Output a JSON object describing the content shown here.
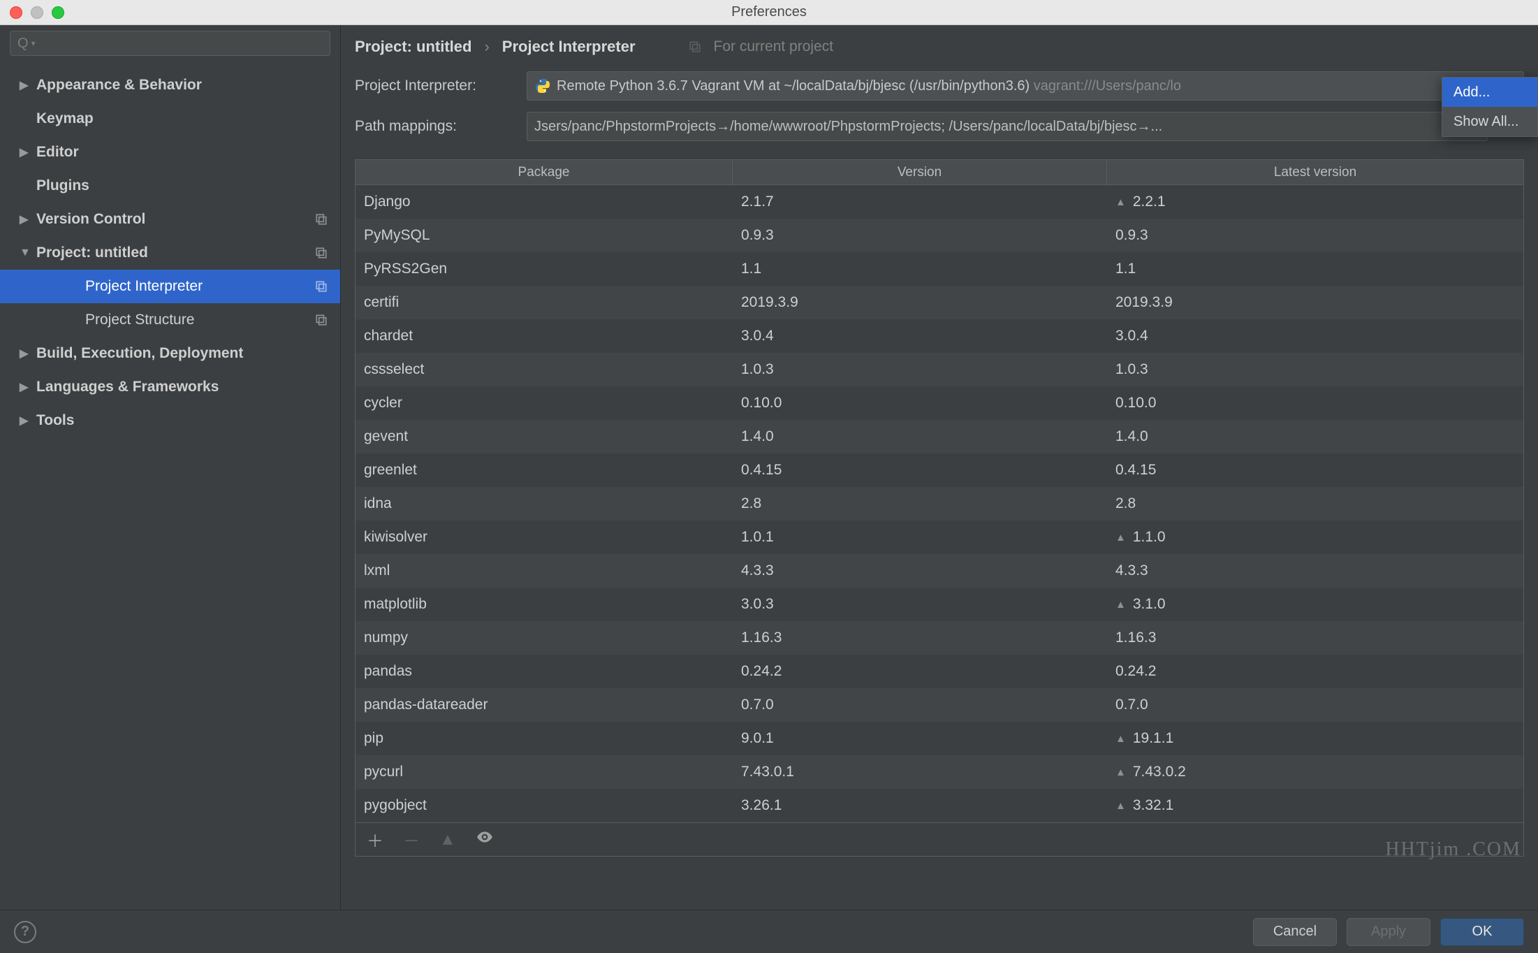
{
  "window": {
    "title": "Preferences"
  },
  "search": {
    "placeholder": "Q▾"
  },
  "sidebar": {
    "items": [
      {
        "label": "Appearance & Behavior",
        "bold": true,
        "arrow": "right",
        "copy": false
      },
      {
        "label": "Keymap",
        "bold": true,
        "arrow": "",
        "copy": false
      },
      {
        "label": "Editor",
        "bold": true,
        "arrow": "right",
        "copy": false
      },
      {
        "label": "Plugins",
        "bold": true,
        "arrow": "",
        "copy": false
      },
      {
        "label": "Version Control",
        "bold": true,
        "arrow": "right",
        "copy": true
      },
      {
        "label": "Project: untitled",
        "bold": true,
        "arrow": "down",
        "copy": true
      },
      {
        "label": "Project Interpreter",
        "bold": false,
        "arrow": "",
        "copy": true,
        "selected": true,
        "grandchild": true
      },
      {
        "label": "Project Structure",
        "bold": false,
        "arrow": "",
        "copy": true,
        "grandchild": true
      },
      {
        "label": "Build, Execution, Deployment",
        "bold": true,
        "arrow": "right",
        "copy": false
      },
      {
        "label": "Languages & Frameworks",
        "bold": true,
        "arrow": "right",
        "copy": false
      },
      {
        "label": "Tools",
        "bold": true,
        "arrow": "right",
        "copy": false
      }
    ]
  },
  "breadcrumb": {
    "root": "Project: untitled",
    "sep": "›",
    "leaf": "Project Interpreter",
    "for_current": "For current project"
  },
  "form": {
    "interpreter_label": "Project Interpreter:",
    "interpreter_value": "Remote Python 3.6.7 Vagrant VM at ~/localData/bj/bjesc (/usr/bin/python3.6)",
    "interpreter_hint": "vagrant:///Users/panc/lo",
    "path_label": "Path mappings:",
    "path_value": "Jsers/panc/PhpstormProjects→/home/wwwroot/PhpstormProjects; /Users/panc/localData/bj/bjesc→..."
  },
  "table": {
    "headers": {
      "pkg": "Package",
      "ver": "Version",
      "lat": "Latest version"
    },
    "rows": [
      {
        "pkg": "Django",
        "ver": "2.1.7",
        "lat": "2.2.1",
        "upgrade": true
      },
      {
        "pkg": "PyMySQL",
        "ver": "0.9.3",
        "lat": "0.9.3",
        "upgrade": false
      },
      {
        "pkg": "PyRSS2Gen",
        "ver": "1.1",
        "lat": "1.1",
        "upgrade": false
      },
      {
        "pkg": "certifi",
        "ver": "2019.3.9",
        "lat": "2019.3.9",
        "upgrade": false
      },
      {
        "pkg": "chardet",
        "ver": "3.0.4",
        "lat": "3.0.4",
        "upgrade": false
      },
      {
        "pkg": "cssselect",
        "ver": "1.0.3",
        "lat": "1.0.3",
        "upgrade": false
      },
      {
        "pkg": "cycler",
        "ver": "0.10.0",
        "lat": "0.10.0",
        "upgrade": false
      },
      {
        "pkg": "gevent",
        "ver": "1.4.0",
        "lat": "1.4.0",
        "upgrade": false
      },
      {
        "pkg": "greenlet",
        "ver": "0.4.15",
        "lat": "0.4.15",
        "upgrade": false
      },
      {
        "pkg": "idna",
        "ver": "2.8",
        "lat": "2.8",
        "upgrade": false
      },
      {
        "pkg": "kiwisolver",
        "ver": "1.0.1",
        "lat": "1.1.0",
        "upgrade": true
      },
      {
        "pkg": "lxml",
        "ver": "4.3.3",
        "lat": "4.3.3",
        "upgrade": false
      },
      {
        "pkg": "matplotlib",
        "ver": "3.0.3",
        "lat": "3.1.0",
        "upgrade": true
      },
      {
        "pkg": "numpy",
        "ver": "1.16.3",
        "lat": "1.16.3",
        "upgrade": false
      },
      {
        "pkg": "pandas",
        "ver": "0.24.2",
        "lat": "0.24.2",
        "upgrade": false
      },
      {
        "pkg": "pandas-datareader",
        "ver": "0.7.0",
        "lat": "0.7.0",
        "upgrade": false
      },
      {
        "pkg": "pip",
        "ver": "9.0.1",
        "lat": "19.1.1",
        "upgrade": true
      },
      {
        "pkg": "pycurl",
        "ver": "7.43.0.1",
        "lat": "7.43.0.2",
        "upgrade": true
      },
      {
        "pkg": "pygobject",
        "ver": "3.26.1",
        "lat": "3.32.1",
        "upgrade": true
      }
    ]
  },
  "popup": {
    "add": "Add...",
    "show_all": "Show All..."
  },
  "footer": {
    "cancel": "Cancel",
    "apply": "Apply",
    "ok": "OK"
  },
  "watermark": "HHTjim .COM"
}
